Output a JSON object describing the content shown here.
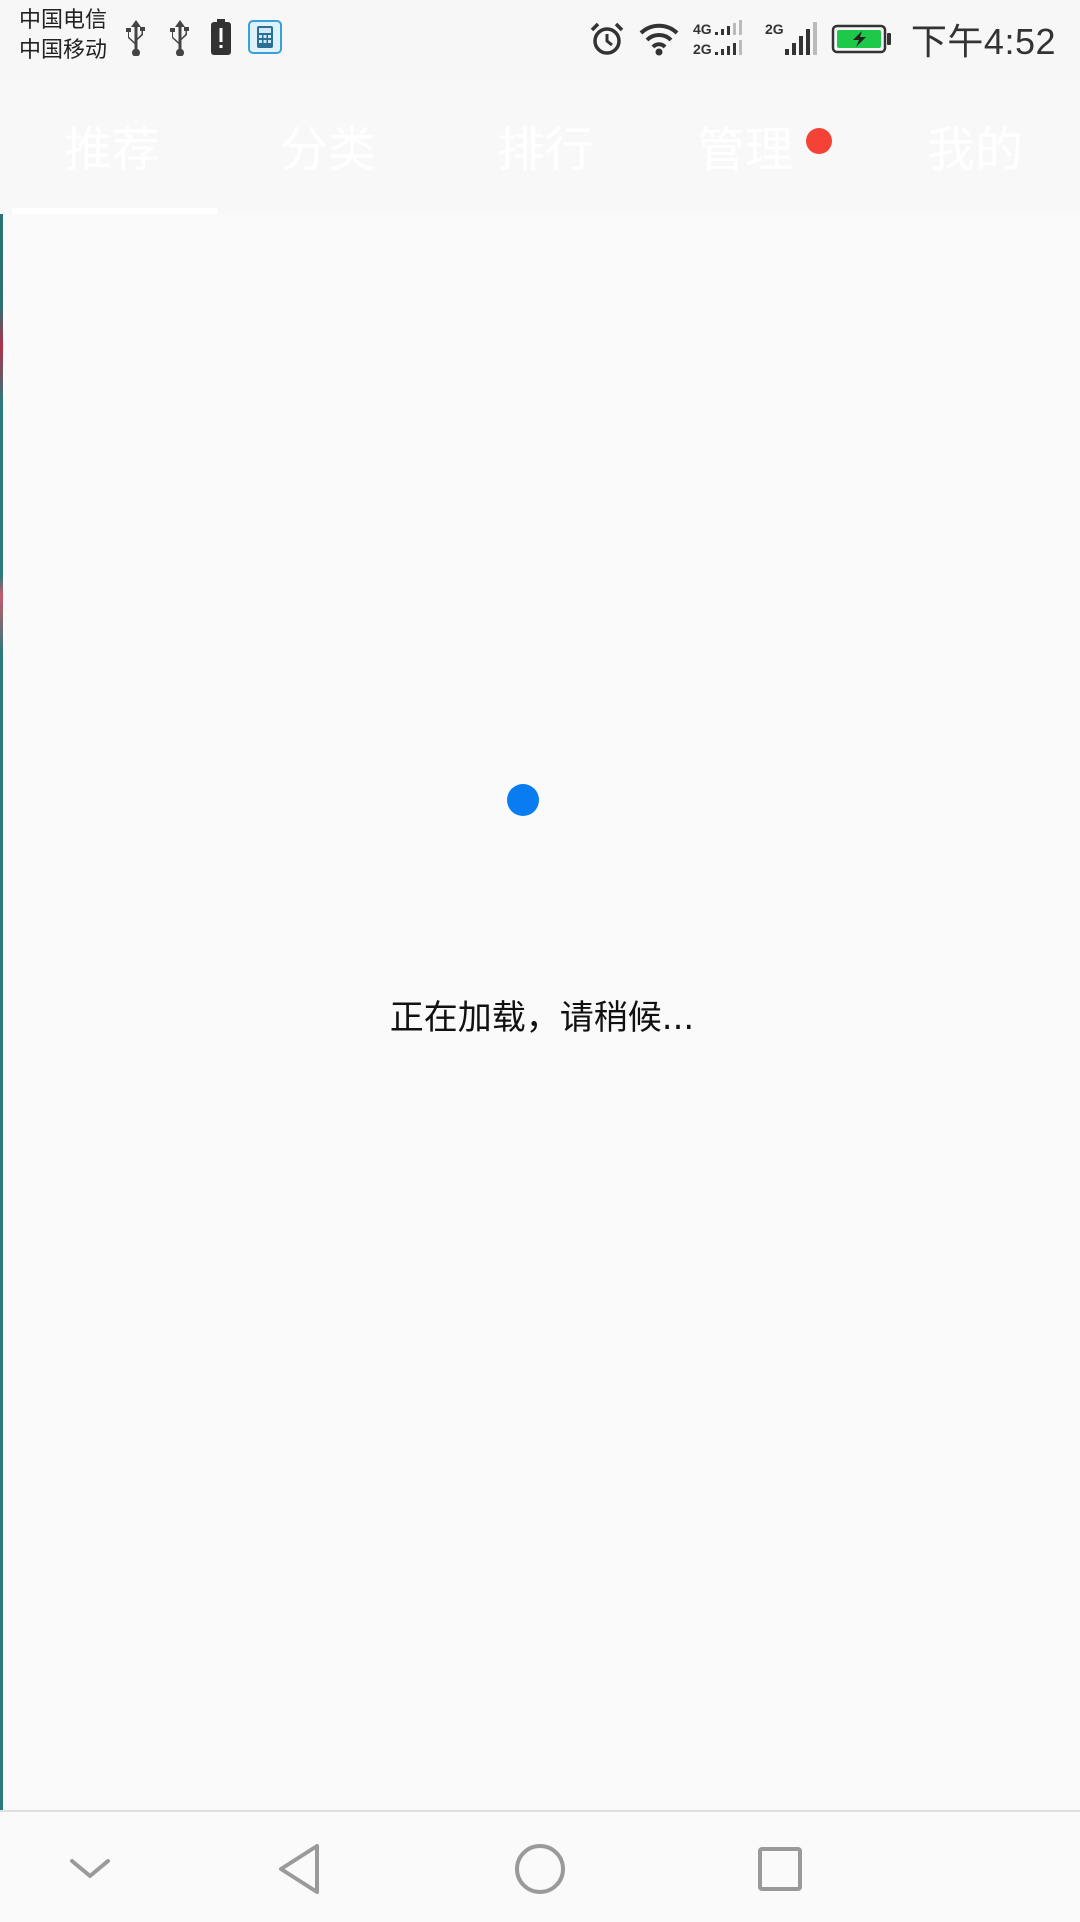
{
  "status_bar": {
    "carrier_1": "中国电信",
    "carrier_2": "中国移动",
    "left_icons": [
      "usb-icon",
      "usb-icon",
      "battery-alert-icon",
      "calculator-app-icon"
    ],
    "right_icons": [
      "alarm-icon",
      "wifi-icon",
      "signal-4g-2g-icon",
      "signal-2g-icon",
      "battery-charging-icon"
    ],
    "time": "下午4:52"
  },
  "tabs": [
    {
      "label": "推荐",
      "selected": true
    },
    {
      "label": "分类",
      "selected": false
    },
    {
      "label": "排行",
      "selected": false
    },
    {
      "label": "管理",
      "selected": false,
      "badge": true
    },
    {
      "label": "我的",
      "selected": false
    }
  ],
  "loading": {
    "text": "正在加载，请稍候..."
  },
  "nav_bar": {
    "buttons": [
      "collapse-icon",
      "back-icon",
      "home-icon",
      "recents-icon"
    ]
  },
  "colors": {
    "accent": "#0a7cf2",
    "badge": "#f44336",
    "background": "#fafafa",
    "battery_fill": "#1ec94a"
  }
}
